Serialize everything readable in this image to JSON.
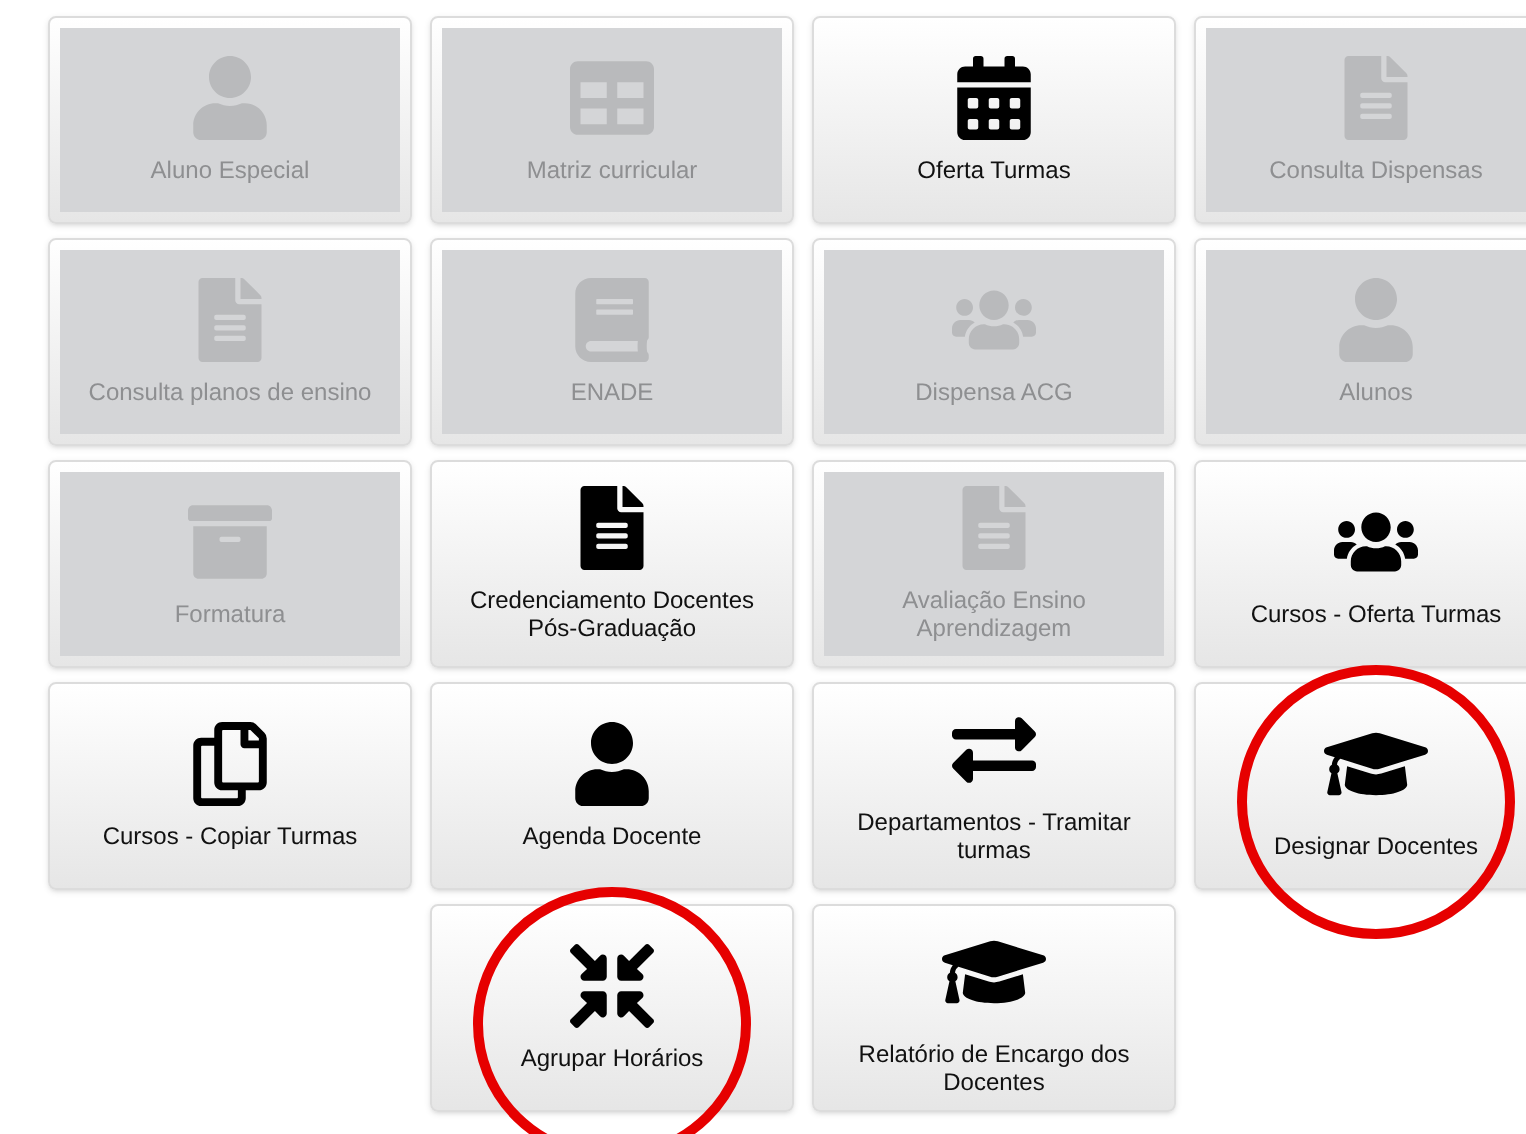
{
  "rows": [
    {
      "tiles": [
        {
          "label": "Aluno Especial",
          "kind": "user",
          "disabled": true,
          "circled": false
        },
        {
          "label": "Matriz curricular",
          "kind": "table",
          "disabled": true,
          "circled": false
        },
        {
          "label": "Oferta Turmas",
          "kind": "calendar",
          "disabled": false,
          "circled": false
        },
        {
          "label": "Consulta Dispensas",
          "kind": "file",
          "disabled": true,
          "circled": false
        }
      ]
    },
    {
      "tiles": [
        {
          "label": "Consulta planos de ensino",
          "kind": "file",
          "disabled": true,
          "circled": false
        },
        {
          "label": "ENADE",
          "kind": "book",
          "disabled": true,
          "circled": false
        },
        {
          "label": "Dispensa ACG",
          "kind": "users",
          "disabled": true,
          "circled": false
        },
        {
          "label": "Alunos",
          "kind": "user",
          "disabled": true,
          "circled": false
        }
      ]
    },
    {
      "tiles": [
        {
          "label": "Formatura",
          "kind": "archive",
          "disabled": true,
          "circled": false
        },
        {
          "label": "Credenciamento Docentes Pós-Graduação",
          "kind": "file",
          "disabled": false,
          "circled": false
        },
        {
          "label": "Avaliação Ensino Aprendizagem",
          "kind": "file",
          "disabled": true,
          "circled": false
        },
        {
          "label": "Cursos - Oferta Turmas",
          "kind": "users",
          "disabled": false,
          "circled": false
        }
      ]
    },
    {
      "tiles": [
        {
          "label": "Cursos - Copiar Turmas",
          "kind": "copy",
          "disabled": false,
          "circled": false
        },
        {
          "label": "Agenda Docente",
          "kind": "user",
          "disabled": false,
          "circled": false
        },
        {
          "label": "Departamentos - Tramitar turmas",
          "kind": "exchange",
          "disabled": false,
          "circled": false
        },
        {
          "label": "Designar Docentes",
          "kind": "graduation",
          "disabled": false,
          "circled": true
        }
      ]
    },
    {
      "tiles": [
        {
          "label": "Agrupar Horários",
          "kind": "compress",
          "disabled": false,
          "circled": true
        },
        {
          "label": "Relatório de Encargo dos Docentes",
          "kind": "graduation",
          "disabled": false,
          "circled": false
        }
      ]
    }
  ]
}
